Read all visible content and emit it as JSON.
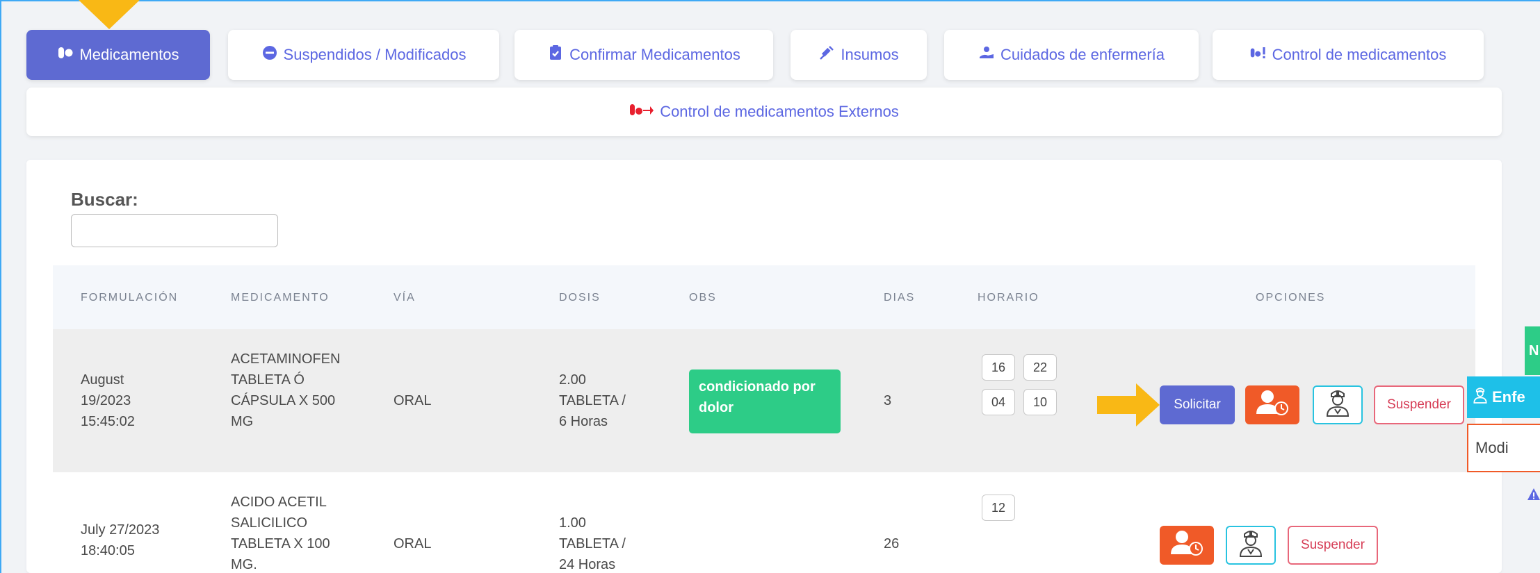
{
  "tabs": [
    {
      "label": "Medicamentos",
      "active": true
    },
    {
      "label": "Suspendidos / Modificados"
    },
    {
      "label": "Confirmar Medicamentos"
    },
    {
      "label": "Insumos"
    },
    {
      "label": "Cuidados de enfermería"
    },
    {
      "label": "Control de medicamentos"
    }
  ],
  "external_tab": {
    "label": "Control de medicamentos Externos"
  },
  "search": {
    "label": "Buscar:",
    "value": ""
  },
  "table": {
    "headers": [
      "FORMULACIÓN",
      "MEDICAMENTO",
      "VÍA",
      "DOSIS",
      "OBS",
      "DIAS",
      "HORARIO",
      "OPCIONES"
    ],
    "rows": [
      {
        "formulacion": [
          "August",
          "19/2023",
          "15:45:02"
        ],
        "medicamento": [
          "ACETAMINOFEN",
          "TABLETA Ó",
          "CÁPSULA X 500",
          "MG"
        ],
        "via": "ORAL",
        "dosis": [
          "2.00",
          "TABLETA /",
          "6 Horas"
        ],
        "obs": [
          "condicionado por",
          "dolor"
        ],
        "dias": "3",
        "horario": [
          "16",
          "22",
          "04",
          "10"
        ],
        "solicitar": "Solicitar",
        "suspender": "Suspender"
      },
      {
        "formulacion": [
          "July 27/2023",
          "18:40:05"
        ],
        "medicamento": [
          "ACIDO ACETIL",
          "SALICILICO",
          "TABLETA X 100",
          "MG."
        ],
        "via": "ORAL",
        "dosis": [
          "1.00",
          "TABLETA /",
          "24 Horas"
        ],
        "obs": [],
        "dias": "26",
        "horario": [
          "12"
        ],
        "suspender": "Suspender"
      }
    ]
  },
  "side_panel": {
    "green_label": "N",
    "cyan_label": "Enfe",
    "outline_label": "Modi"
  },
  "colors": {
    "primary": "#5e6ad2",
    "success": "#2dcc87",
    "orange": "#f05a28",
    "cyan": "#28c3e0",
    "danger": "#d63c55",
    "highlight_arrow": "#f9b815"
  },
  "icons": {
    "medicamentos": "pills-icon",
    "suspendidos": "minus-circle-icon",
    "confirmar": "clipboard-check-icon",
    "insumos": "syringe-icon",
    "cuidados": "hand-holding-user-icon",
    "control": "pills-exclamation-icon",
    "externos": "pills-arrow-icon",
    "orange_btn": "user-clock-icon",
    "cyan_btn": "nurse-icon",
    "warning": "warning-icon"
  }
}
